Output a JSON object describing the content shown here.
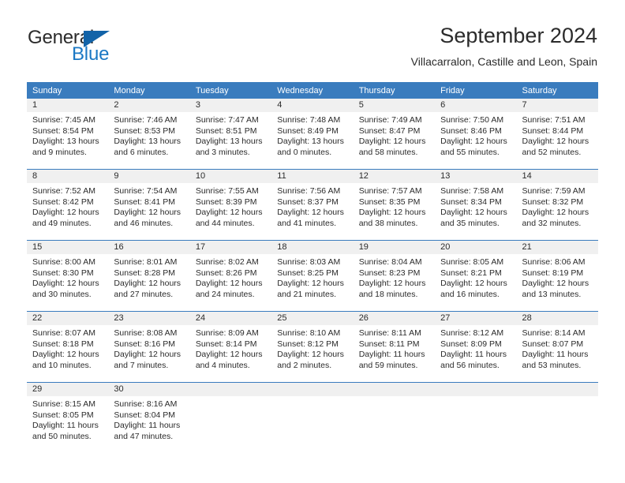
{
  "brand": {
    "name_part1": "General",
    "name_part2": "Blue",
    "accent_color": "#1b78c4",
    "triangle_color": "#1263a8"
  },
  "header": {
    "title": "September 2024",
    "subtitle": "Villacarralon, Castille and Leon, Spain"
  },
  "theme": {
    "header_row_bg": "#3a7cbe",
    "daynum_bg": "#f0f0f0",
    "text_color": "#2b2b2b",
    "separator_color": "#3a7cbe"
  },
  "weekdays": [
    "Sunday",
    "Monday",
    "Tuesday",
    "Wednesday",
    "Thursday",
    "Friday",
    "Saturday"
  ],
  "labels": {
    "sunrise_prefix": "Sunrise:",
    "sunset_prefix": "Sunset:",
    "daylight_prefix": "Daylight:"
  },
  "weeks": [
    [
      {
        "day": "1",
        "sunrise": "Sunrise: 7:45 AM",
        "sunset": "Sunset: 8:54 PM",
        "daylight1": "Daylight: 13 hours",
        "daylight2": "and 9 minutes."
      },
      {
        "day": "2",
        "sunrise": "Sunrise: 7:46 AM",
        "sunset": "Sunset: 8:53 PM",
        "daylight1": "Daylight: 13 hours",
        "daylight2": "and 6 minutes."
      },
      {
        "day": "3",
        "sunrise": "Sunrise: 7:47 AM",
        "sunset": "Sunset: 8:51 PM",
        "daylight1": "Daylight: 13 hours",
        "daylight2": "and 3 minutes."
      },
      {
        "day": "4",
        "sunrise": "Sunrise: 7:48 AM",
        "sunset": "Sunset: 8:49 PM",
        "daylight1": "Daylight: 13 hours",
        "daylight2": "and 0 minutes."
      },
      {
        "day": "5",
        "sunrise": "Sunrise: 7:49 AM",
        "sunset": "Sunset: 8:47 PM",
        "daylight1": "Daylight: 12 hours",
        "daylight2": "and 58 minutes."
      },
      {
        "day": "6",
        "sunrise": "Sunrise: 7:50 AM",
        "sunset": "Sunset: 8:46 PM",
        "daylight1": "Daylight: 12 hours",
        "daylight2": "and 55 minutes."
      },
      {
        "day": "7",
        "sunrise": "Sunrise: 7:51 AM",
        "sunset": "Sunset: 8:44 PM",
        "daylight1": "Daylight: 12 hours",
        "daylight2": "and 52 minutes."
      }
    ],
    [
      {
        "day": "8",
        "sunrise": "Sunrise: 7:52 AM",
        "sunset": "Sunset: 8:42 PM",
        "daylight1": "Daylight: 12 hours",
        "daylight2": "and 49 minutes."
      },
      {
        "day": "9",
        "sunrise": "Sunrise: 7:54 AM",
        "sunset": "Sunset: 8:41 PM",
        "daylight1": "Daylight: 12 hours",
        "daylight2": "and 46 minutes."
      },
      {
        "day": "10",
        "sunrise": "Sunrise: 7:55 AM",
        "sunset": "Sunset: 8:39 PM",
        "daylight1": "Daylight: 12 hours",
        "daylight2": "and 44 minutes."
      },
      {
        "day": "11",
        "sunrise": "Sunrise: 7:56 AM",
        "sunset": "Sunset: 8:37 PM",
        "daylight1": "Daylight: 12 hours",
        "daylight2": "and 41 minutes."
      },
      {
        "day": "12",
        "sunrise": "Sunrise: 7:57 AM",
        "sunset": "Sunset: 8:35 PM",
        "daylight1": "Daylight: 12 hours",
        "daylight2": "and 38 minutes."
      },
      {
        "day": "13",
        "sunrise": "Sunrise: 7:58 AM",
        "sunset": "Sunset: 8:34 PM",
        "daylight1": "Daylight: 12 hours",
        "daylight2": "and 35 minutes."
      },
      {
        "day": "14",
        "sunrise": "Sunrise: 7:59 AM",
        "sunset": "Sunset: 8:32 PM",
        "daylight1": "Daylight: 12 hours",
        "daylight2": "and 32 minutes."
      }
    ],
    [
      {
        "day": "15",
        "sunrise": "Sunrise: 8:00 AM",
        "sunset": "Sunset: 8:30 PM",
        "daylight1": "Daylight: 12 hours",
        "daylight2": "and 30 minutes."
      },
      {
        "day": "16",
        "sunrise": "Sunrise: 8:01 AM",
        "sunset": "Sunset: 8:28 PM",
        "daylight1": "Daylight: 12 hours",
        "daylight2": "and 27 minutes."
      },
      {
        "day": "17",
        "sunrise": "Sunrise: 8:02 AM",
        "sunset": "Sunset: 8:26 PM",
        "daylight1": "Daylight: 12 hours",
        "daylight2": "and 24 minutes."
      },
      {
        "day": "18",
        "sunrise": "Sunrise: 8:03 AM",
        "sunset": "Sunset: 8:25 PM",
        "daylight1": "Daylight: 12 hours",
        "daylight2": "and 21 minutes."
      },
      {
        "day": "19",
        "sunrise": "Sunrise: 8:04 AM",
        "sunset": "Sunset: 8:23 PM",
        "daylight1": "Daylight: 12 hours",
        "daylight2": "and 18 minutes."
      },
      {
        "day": "20",
        "sunrise": "Sunrise: 8:05 AM",
        "sunset": "Sunset: 8:21 PM",
        "daylight1": "Daylight: 12 hours",
        "daylight2": "and 16 minutes."
      },
      {
        "day": "21",
        "sunrise": "Sunrise: 8:06 AM",
        "sunset": "Sunset: 8:19 PM",
        "daylight1": "Daylight: 12 hours",
        "daylight2": "and 13 minutes."
      }
    ],
    [
      {
        "day": "22",
        "sunrise": "Sunrise: 8:07 AM",
        "sunset": "Sunset: 8:18 PM",
        "daylight1": "Daylight: 12 hours",
        "daylight2": "and 10 minutes."
      },
      {
        "day": "23",
        "sunrise": "Sunrise: 8:08 AM",
        "sunset": "Sunset: 8:16 PM",
        "daylight1": "Daylight: 12 hours",
        "daylight2": "and 7 minutes."
      },
      {
        "day": "24",
        "sunrise": "Sunrise: 8:09 AM",
        "sunset": "Sunset: 8:14 PM",
        "daylight1": "Daylight: 12 hours",
        "daylight2": "and 4 minutes."
      },
      {
        "day": "25",
        "sunrise": "Sunrise: 8:10 AM",
        "sunset": "Sunset: 8:12 PM",
        "daylight1": "Daylight: 12 hours",
        "daylight2": "and 2 minutes."
      },
      {
        "day": "26",
        "sunrise": "Sunrise: 8:11 AM",
        "sunset": "Sunset: 8:11 PM",
        "daylight1": "Daylight: 11 hours",
        "daylight2": "and 59 minutes."
      },
      {
        "day": "27",
        "sunrise": "Sunrise: 8:12 AM",
        "sunset": "Sunset: 8:09 PM",
        "daylight1": "Daylight: 11 hours",
        "daylight2": "and 56 minutes."
      },
      {
        "day": "28",
        "sunrise": "Sunrise: 8:14 AM",
        "sunset": "Sunset: 8:07 PM",
        "daylight1": "Daylight: 11 hours",
        "daylight2": "and 53 minutes."
      }
    ],
    [
      {
        "day": "29",
        "sunrise": "Sunrise: 8:15 AM",
        "sunset": "Sunset: 8:05 PM",
        "daylight1": "Daylight: 11 hours",
        "daylight2": "and 50 minutes."
      },
      {
        "day": "30",
        "sunrise": "Sunrise: 8:16 AM",
        "sunset": "Sunset: 8:04 PM",
        "daylight1": "Daylight: 11 hours",
        "daylight2": "and 47 minutes."
      },
      {
        "day": "",
        "sunrise": "",
        "sunset": "",
        "daylight1": "",
        "daylight2": ""
      },
      {
        "day": "",
        "sunrise": "",
        "sunset": "",
        "daylight1": "",
        "daylight2": ""
      },
      {
        "day": "",
        "sunrise": "",
        "sunset": "",
        "daylight1": "",
        "daylight2": ""
      },
      {
        "day": "",
        "sunrise": "",
        "sunset": "",
        "daylight1": "",
        "daylight2": ""
      },
      {
        "day": "",
        "sunrise": "",
        "sunset": "",
        "daylight1": "",
        "daylight2": ""
      }
    ]
  ]
}
